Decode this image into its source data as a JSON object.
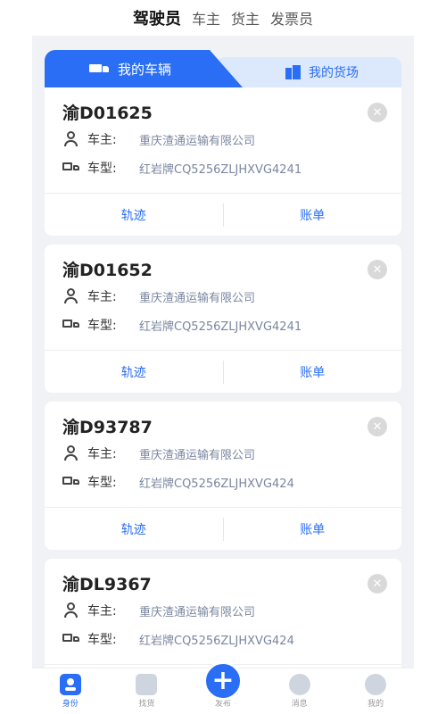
{
  "top_tabs": [
    "驾驶员",
    "车主",
    "货主",
    "发票员"
  ],
  "sub_tabs": {
    "active": "我的车辆",
    "inactive": "我的货场"
  },
  "labels": {
    "owner": "车主:",
    "model": "车型:",
    "track": "轨迹",
    "bill": "账单"
  },
  "vehicles": [
    {
      "plate": "渝D01625",
      "owner": "重庆渣通运输有限公司",
      "model": "红岩牌CQ5256ZLJHXVG4241"
    },
    {
      "plate": "渝D01652",
      "owner": "重庆渣通运输有限公司",
      "model": "红岩牌CQ5256ZLJHXVG4241"
    },
    {
      "plate": "渝D93787",
      "owner": "重庆渣通运输有限公司",
      "model": "红岩牌CQ5256ZLJHXVG424"
    },
    {
      "plate": "渝DL9367",
      "owner": "重庆渣通运输有限公司",
      "model": "红岩牌CQ5256ZLJHXVG424"
    }
  ],
  "bottom_nav": [
    "身份",
    "找货",
    "发布",
    "消息",
    "我的"
  ],
  "colors": {
    "accent": "#2a6ef5",
    "panel_bg": "#f0f2f5"
  }
}
